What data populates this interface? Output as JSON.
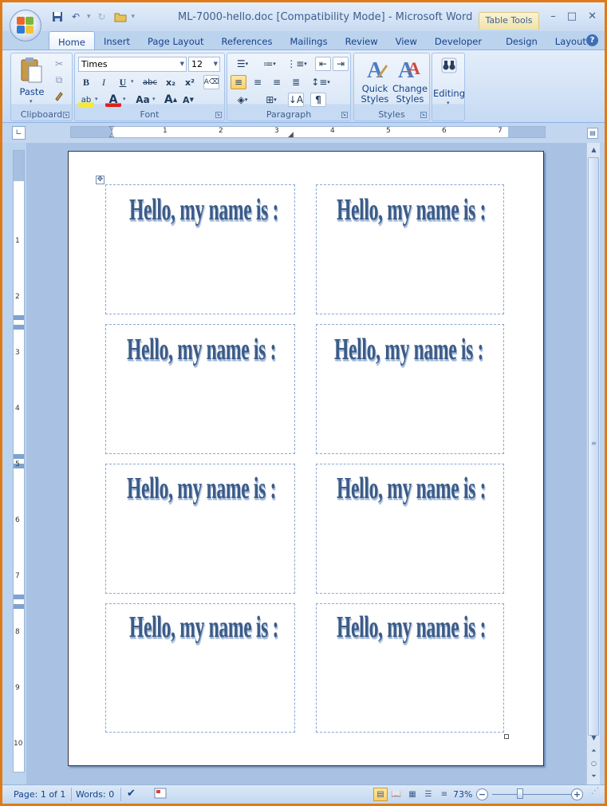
{
  "window": {
    "title": "ML-7000-hello.doc [Compatibility Mode] - Microsoft Word",
    "context_tab_group": "Table Tools",
    "controls": [
      "–",
      "□",
      "✕"
    ]
  },
  "tabs": [
    "Home",
    "Insert",
    "Page Layout",
    "References",
    "Mailings",
    "Review",
    "View",
    "Developer",
    "Design",
    "Layout"
  ],
  "active_tab": "Home",
  "ribbon": {
    "clipboard": {
      "label": "Clipboard",
      "paste": "Paste"
    },
    "font": {
      "label": "Font",
      "font_name": "Times",
      "font_size": "12",
      "bold": "B",
      "italic": "I",
      "underline": "U",
      "strike": "abc",
      "subscript": "x₂",
      "superscript": "x²",
      "highlight": "ab",
      "font_color": "A",
      "change_case": "Aa",
      "grow": "A",
      "shrink": "A"
    },
    "paragraph": {
      "label": "Paragraph"
    },
    "styles": {
      "label": "Styles",
      "quick_styles": "Quick Styles",
      "change_styles": "Change Styles"
    },
    "editing": {
      "label": "Editing"
    }
  },
  "ruler": {
    "h_numbers": [
      "1",
      "2",
      "3",
      "4",
      "5",
      "6",
      "7"
    ],
    "v_numbers": [
      "1",
      "2",
      "3",
      "4",
      "5",
      "6",
      "7",
      "8",
      "9",
      "10"
    ]
  },
  "document": {
    "labels": [
      "Hello, my name is :",
      "Hello, my name is :",
      "Hello, my name is :",
      "Hello, my name is :",
      "Hello, my name is :",
      "Hello, my name is :",
      "Hello, my name is :",
      "Hello, my name is :"
    ]
  },
  "statusbar": {
    "page": "Page: 1 of 1",
    "words": "Words: 0",
    "zoom": "73%",
    "zoom_level_percent": 73
  },
  "colors": {
    "accent": "#15428b",
    "frame": "#e07a16",
    "label_text": "#3c5b86"
  }
}
